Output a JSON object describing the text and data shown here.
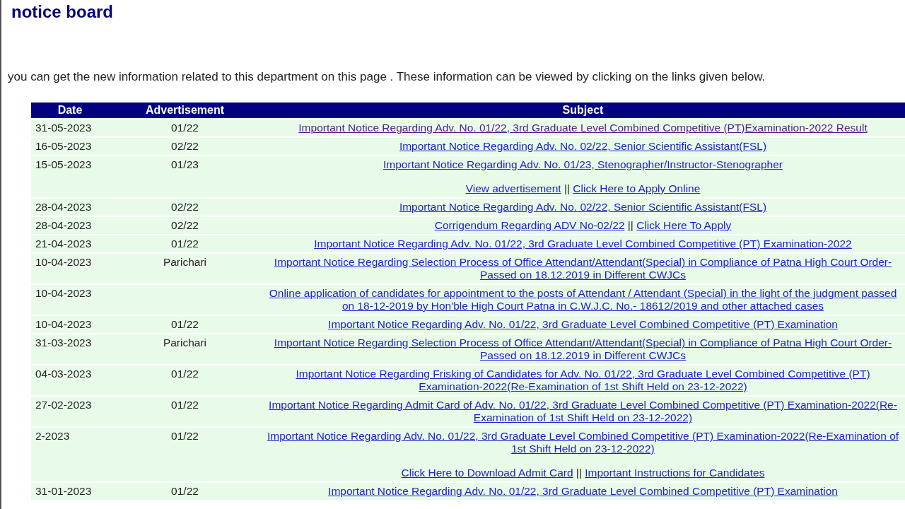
{
  "title": "notice board",
  "intro": "you can get the new information related to this department on this page . These information can be viewed by clicking on the links given below.",
  "table": {
    "columns": [
      "Date",
      "Advertisement",
      "Subject"
    ],
    "rows": [
      {
        "date": "31-05-2023",
        "advertisement": "01/22",
        "links": [
          {
            "text": "Important Notice Regarding Adv. No. 01/22, 3rd Graduate Level Combined Competitive (PT)Examination-2022 Result",
            "visited": true
          }
        ]
      },
      {
        "date": "16-05-2023",
        "advertisement": "02/22",
        "links": [
          {
            "text": "Important Notice Regarding Adv. No. 02/22, Senior Scientific Assistant(FSL)",
            "visited": false
          }
        ]
      },
      {
        "date": "15-05-2023",
        "advertisement": "01/23",
        "links": [
          {
            "text": "Important Notice Regarding Adv. No. 01/23, Stenographer/Instructor-Stenographer",
            "visited": false
          }
        ],
        "more": {
          "separator": "||",
          "links": [
            {
              "text": "View advertisement",
              "visited": false
            },
            {
              "text": "Click Here to Apply Online",
              "visited": false
            }
          ]
        }
      },
      {
        "date": "28-04-2023",
        "advertisement": "02/22",
        "links": [
          {
            "text": "Important Notice Regarding Adv. No. 02/22, Senior Scientific Assistant(FSL)",
            "visited": false
          }
        ]
      },
      {
        "date": "28-04-2023",
        "advertisement": "02/22",
        "separator": "||",
        "links": [
          {
            "text": "Corrigendum Regarding ADV No-02/22",
            "visited": false
          },
          {
            "text": "Click Here To Apply",
            "visited": false
          }
        ]
      },
      {
        "date": "21-04-2023",
        "advertisement": "01/22",
        "links": [
          {
            "text": "Important Notice Regarding Adv. No. 01/22, 3rd Graduate Level Combined Competitive (PT) Examination-2022",
            "visited": false
          }
        ]
      },
      {
        "date": "10-04-2023",
        "advertisement": "Parichari",
        "links": [
          {
            "text": "Important Notice Regarding Selection Process of Office Attendant/Attendant(Special) in Compliance of Patna High Court Order-Passed on 18.12.2019 in Different CWJCs",
            "visited": false
          }
        ]
      },
      {
        "date": "10-04-2023",
        "links": [
          {
            "text": "Online application of candidates for appointment to the posts of Attendant / Attendant (Special) in the light of the judgment passed on 18-12-2019 by Hon'ble High Court Patna in C.W.J.C. No.- 18612/2019 and other attached cases",
            "visited": false
          }
        ]
      },
      {
        "date": "10-04-2023",
        "advertisement": "01/22",
        "links": [
          {
            "text": "Important Notice Regarding Adv. No. 01/22, 3rd Graduate Level Combined Competitive (PT) Examination",
            "visited": false
          }
        ]
      },
      {
        "date": "31-03-2023",
        "advertisement": "Parichari",
        "links": [
          {
            "text": "Important Notice Regarding Selection Process of Office Attendant/Attendant(Special) in Compliance of Patna High Court Order-Passed on 18.12.2019 in Different CWJCs",
            "visited": false
          }
        ]
      },
      {
        "date": "04-03-2023",
        "advertisement": "01/22",
        "links": [
          {
            "text": "Important Notice Regarding Frisking of Candidates for Adv. No. 01/22, 3rd Graduate Level Combined Competitive (PT) Examination-2022(Re-Examination of 1st Shift Held on 23-12-2022)",
            "visited": false
          }
        ]
      },
      {
        "date": "27-02-2023",
        "advertisement": "01/22",
        "links": [
          {
            "text": "Important Notice Regarding Admit Card of Adv. No. 01/22, 3rd Graduate Level Combined Competitive (PT) Examination-2022(Re-Examination of 1st Shift Held on 23-12-2022)",
            "visited": false
          }
        ]
      },
      {
        "date": "2-2023",
        "advertisement": "01/22",
        "links": [
          {
            "text": "Important Notice Regarding Adv. No. 01/22, 3rd Graduate Level Combined Competitive (PT) Examination-2022(Re-Examination of 1st Shift Held on 23-12-2022)",
            "visited": false
          }
        ],
        "more": {
          "separator": "||",
          "links": [
            {
              "text": "Click Here to Download Admit Card",
              "visited": false
            },
            {
              "text": "Important Instructions for Candidates",
              "visited": false
            }
          ]
        }
      },
      {
        "date": "31-01-2023",
        "advertisement": "01/22",
        "links": [
          {
            "text": "Important Notice Regarding Adv. No. 01/22, 3rd Graduate Level Combined Competitive (PT) Examination",
            "visited": false
          }
        ]
      }
    ]
  }
}
